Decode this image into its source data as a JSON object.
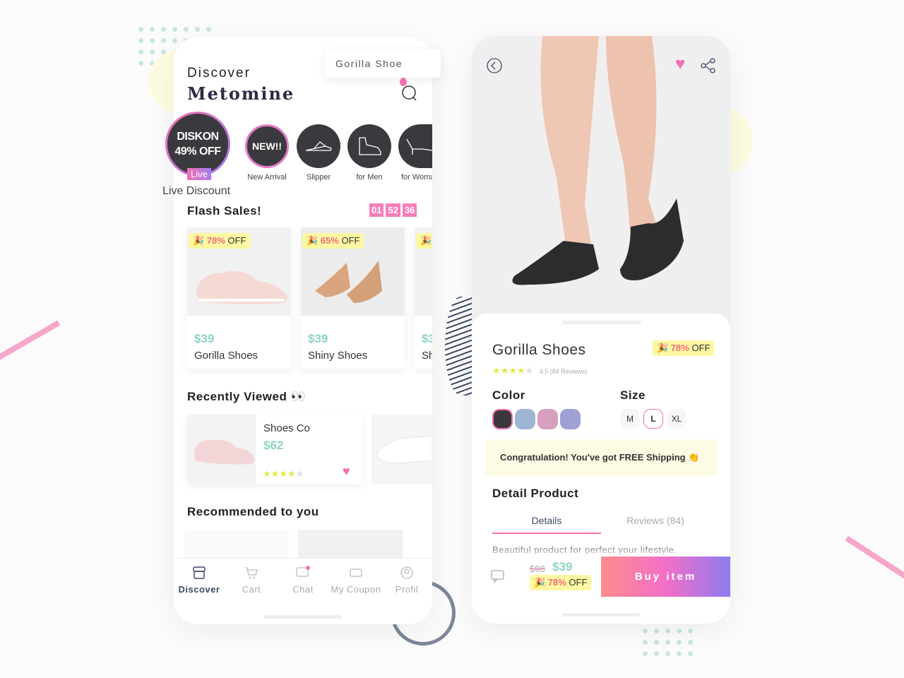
{
  "left_phone": {
    "greeting": "Discover",
    "brand": "Metomine",
    "search_value": "Gorilla Shoe",
    "live": {
      "line1": "DISKON",
      "line2": "49% OFF",
      "tag": "Live",
      "label": "Live Discount"
    },
    "categories": [
      {
        "icon": "new-badge",
        "text": "NEW!!",
        "label": "New Arrival"
      },
      {
        "icon": "slipper-icon",
        "label": "Slipper"
      },
      {
        "icon": "boot-icon",
        "label": "for Men"
      },
      {
        "icon": "heel-icon",
        "label": "for Woma"
      }
    ],
    "flash": {
      "title": "Flash Sales!",
      "timer": [
        "01",
        "52",
        "36"
      ],
      "items": [
        {
          "pct": "78%",
          "off": "OFF",
          "price": "$39",
          "name": "Gorilla Shoes"
        },
        {
          "pct": "65%",
          "off": "OFF",
          "price": "$39",
          "name": "Shiny Shoes"
        },
        {
          "pct": "",
          "off": "",
          "price": "$3",
          "name": "Sh"
        }
      ]
    },
    "recent": {
      "title": "Recently Viewed 👀",
      "item": {
        "name": "Shoes Co",
        "price": "$62",
        "rating": 4
      }
    },
    "recommended_title": "Recommended to you",
    "nav": [
      {
        "label": "Discover",
        "active": true
      },
      {
        "label": "Cart"
      },
      {
        "label": "Chat"
      },
      {
        "label": "My Coupon"
      },
      {
        "label": "Profil"
      }
    ]
  },
  "right_phone": {
    "name": "Gorilla Shoes",
    "discount_pct": "78%",
    "discount_off": "OFF",
    "rating": 4,
    "rating_text": "4.5 (84 Reviews)",
    "color_label": "Color",
    "colors": [
      "#3a383c",
      "#9fb5d4",
      "#d69fbd",
      "#9fa0d4"
    ],
    "size_label": "Size",
    "sizes": [
      "M",
      "L",
      "XL"
    ],
    "selected_size": "L",
    "shipping": "Congratulation! You've got FREE Shipping 👏",
    "detail_title": "Detail Product",
    "tabs": [
      "Details",
      "Reviews (84)"
    ],
    "description": "Beautiful product for perfect your lifestyle.",
    "old_price": "$98",
    "price": "$39",
    "buy": "Buy item"
  },
  "colors": {
    "accent_pink": "#f36fb0",
    "accent_purple": "#8c7cf0",
    "price_green": "#8fd3c4",
    "badge_yellow": "#fdf7a3"
  }
}
